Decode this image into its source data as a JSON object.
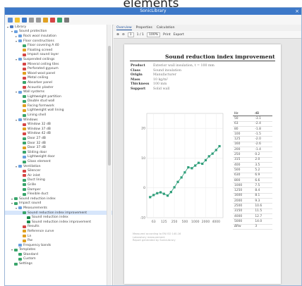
{
  "header": {
    "title": "elements"
  },
  "window": {
    "title": "SonicLibrary",
    "close": "×"
  },
  "tree": {
    "items": [
      {
        "label": "Library",
        "indent": 0,
        "color": "#4a78c2",
        "exp": "▾"
      },
      {
        "label": "Sound protection",
        "indent": 1,
        "color": "#6aa0e0",
        "exp": "▾"
      },
      {
        "label": "Rock wool insulation",
        "indent": 2,
        "color": "#6aa0e0",
        "exp": "▸"
      },
      {
        "label": "Floor constructions",
        "indent": 2,
        "color": "#6aa0e0",
        "exp": "▾"
      },
      {
        "label": "Floor covering A 40",
        "indent": 3,
        "color": "#39a56b",
        "exp": ""
      },
      {
        "label": "Floating screed",
        "indent": 3,
        "color": "#e0a020",
        "exp": ""
      },
      {
        "label": "Impact sound layer",
        "indent": 3,
        "color": "#d64545",
        "exp": ""
      },
      {
        "label": "Suspended ceilings",
        "indent": 2,
        "color": "#6aa0e0",
        "exp": "▾"
      },
      {
        "label": "Mineral ceiling tiles",
        "indent": 3,
        "color": "#d64545",
        "exp": ""
      },
      {
        "label": "Perforated gypsum",
        "indent": 3,
        "color": "#d64545",
        "exp": ""
      },
      {
        "label": "Wood wool panel",
        "indent": 3,
        "color": "#e0a020",
        "exp": ""
      },
      {
        "label": "Metal ceiling",
        "indent": 3,
        "color": "#d64545",
        "exp": ""
      },
      {
        "label": "Absorber panel",
        "indent": 3,
        "color": "#39a56b",
        "exp": ""
      },
      {
        "label": "Acoustic plaster",
        "indent": 3,
        "color": "#d64545",
        "exp": ""
      },
      {
        "label": "Wall systems",
        "indent": 2,
        "color": "#6aa0e0",
        "exp": "▾"
      },
      {
        "label": "Lightweight partition",
        "indent": 3,
        "color": "#39a56b",
        "exp": ""
      },
      {
        "label": "Double stud wall",
        "indent": 3,
        "color": "#39a56b",
        "exp": ""
      },
      {
        "label": "Facing formwork",
        "indent": 3,
        "color": "#e0a020",
        "exp": ""
      },
      {
        "label": "Lightweight wall lining",
        "indent": 3,
        "color": "#e0a020",
        "exp": ""
      },
      {
        "label": "Lining shell",
        "indent": 3,
        "color": "#39a56b",
        "exp": ""
      },
      {
        "label": "Windows",
        "indent": 2,
        "color": "#6aa0e0",
        "exp": "▾"
      },
      {
        "label": "Window 32 dB",
        "indent": 3,
        "color": "#d64545",
        "exp": ""
      },
      {
        "label": "Window 37 dB",
        "indent": 3,
        "color": "#e0a020",
        "exp": ""
      },
      {
        "label": "Window 42 dB",
        "indent": 3,
        "color": "#d64545",
        "exp": ""
      },
      {
        "label": "Door 27 dB",
        "indent": 3,
        "color": "#39a56b",
        "exp": ""
      },
      {
        "label": "Door 32 dB",
        "indent": 3,
        "color": "#39a56b",
        "exp": ""
      },
      {
        "label": "Door 37 dB",
        "indent": 3,
        "color": "#e0a020",
        "exp": ""
      },
      {
        "label": "Sliding door",
        "indent": 3,
        "color": "#39a56b",
        "exp": ""
      },
      {
        "label": "Lightweight door",
        "indent": 3,
        "color": "#6aa0e0",
        "exp": ""
      },
      {
        "label": "Glass element",
        "indent": 3,
        "color": "#39a56b",
        "exp": ""
      },
      {
        "label": "Ventilation",
        "indent": 2,
        "color": "#6aa0e0",
        "exp": "▾"
      },
      {
        "label": "Silencer",
        "indent": 3,
        "color": "#d64545",
        "exp": ""
      },
      {
        "label": "Air inlet",
        "indent": 3,
        "color": "#d64545",
        "exp": ""
      },
      {
        "label": "Duct lining",
        "indent": 3,
        "color": "#39a56b",
        "exp": ""
      },
      {
        "label": "Grille",
        "indent": 3,
        "color": "#39a56b",
        "exp": ""
      },
      {
        "label": "Damper",
        "indent": 3,
        "color": "#39a56b",
        "exp": ""
      },
      {
        "label": "Flexible duct",
        "indent": 3,
        "color": "#39a56b",
        "exp": ""
      },
      {
        "label": "Sound reduction index",
        "indent": 1,
        "color": "#39a56b",
        "exp": "▾"
      },
      {
        "label": "Impact sound",
        "indent": 1,
        "color": "#39a56b",
        "exp": "▾"
      },
      {
        "label": "Measurements",
        "indent": 2,
        "color": "#6aa0e0",
        "exp": "▾"
      },
      {
        "label": "Sound reduction index improvement",
        "indent": 3,
        "color": "#39a56b",
        "exp": "",
        "sel": true
      },
      {
        "label": "Sound reduction index",
        "indent": 4,
        "color": "#1b8a4c",
        "exp": ""
      },
      {
        "label": "Sound reduction index improvement",
        "indent": 4,
        "color": "#1b8a4c",
        "exp": ""
      },
      {
        "label": "Results",
        "indent": 3,
        "color": "#d64545",
        "exp": ""
      },
      {
        "label": "Reference curve",
        "indent": 3,
        "color": "#e0a020",
        "exp": ""
      },
      {
        "label": "Ln",
        "indent": 3,
        "color": "#e0a020",
        "exp": ""
      },
      {
        "label": "Rw",
        "indent": 3,
        "color": "#e0a020",
        "exp": ""
      },
      {
        "label": "Frequency bands",
        "indent": 2,
        "color": "#6aa0e0",
        "exp": ""
      },
      {
        "label": "Templates",
        "indent": 1,
        "color": "#39a56b",
        "exp": "▾"
      },
      {
        "label": "Standard",
        "indent": 2,
        "color": "#39a56b",
        "exp": ""
      },
      {
        "label": "Custom",
        "indent": 2,
        "color": "#39a56b",
        "exp": ""
      },
      {
        "label": "Settings",
        "indent": 1,
        "color": "#39a56b",
        "exp": ""
      }
    ]
  },
  "right": {
    "tabs": [
      {
        "label": "Overview"
      },
      {
        "label": "Properties"
      },
      {
        "label": "Calculation"
      }
    ],
    "toolbar": {
      "page": "1",
      "pages": "1 / 1",
      "zoom": "100%",
      "print": "Print",
      "export": "Export"
    }
  },
  "report": {
    "title": "Sound reduction index improvement",
    "props": [
      {
        "k": "Product",
        "v": "Exterior wall insulation, t = 100 mm"
      },
      {
        "k": "Class",
        "v": "Sound insulation"
      },
      {
        "k": "Origin",
        "v": "Manufacturer"
      },
      {
        "k": "Mass",
        "v": "10 kg/m²"
      },
      {
        "k": "Thickness",
        "v": "100 mm"
      },
      {
        "k": "Support",
        "v": "Solid wall"
      }
    ],
    "table": {
      "headers": [
        "Hz",
        "dB"
      ],
      "rows": [
        [
          "50",
          "-3.1"
        ],
        [
          "63",
          "-2.4"
        ],
        [
          "80",
          "-1.8"
        ],
        [
          "100",
          "-1.5"
        ],
        [
          "125",
          "-2.0"
        ],
        [
          "160",
          "-2.6"
        ],
        [
          "200",
          "-1.4"
        ],
        [
          "250",
          "0.2"
        ],
        [
          "315",
          "2.0"
        ],
        [
          "400",
          "3.5"
        ],
        [
          "500",
          "5.2"
        ],
        [
          "630",
          "6.9"
        ],
        [
          "800",
          "6.6"
        ],
        [
          "1000",
          "7.5"
        ],
        [
          "1250",
          "8.4"
        ],
        [
          "1600",
          "8.1"
        ],
        [
          "2000",
          "9.3"
        ],
        [
          "2500",
          "10.6"
        ],
        [
          "3150",
          "11.5"
        ],
        [
          "4000",
          "12.7"
        ],
        [
          "5000",
          "14.0"
        ],
        [
          "ΔRw",
          "3"
        ]
      ]
    },
    "note": [
      "Measured according to EN ISO 140-16",
      "Laboratory measurement",
      "Report generated by SonicLibrary"
    ]
  },
  "chart_data": {
    "type": "line",
    "x": [
      50,
      63,
      80,
      100,
      125,
      160,
      200,
      250,
      315,
      400,
      500,
      630,
      800,
      1000,
      1250,
      1600,
      2000,
      2500,
      3150,
      4000,
      5000
    ],
    "values": [
      -3.1,
      -2.4,
      -1.8,
      -1.5,
      -2.0,
      -2.6,
      -1.4,
      0.2,
      2.0,
      3.5,
      5.2,
      6.9,
      6.6,
      7.5,
      8.4,
      8.1,
      9.3,
      10.6,
      11.5,
      12.7,
      14.0
    ],
    "xticks": [
      "63",
      "125",
      "250",
      "500",
      "1000",
      "2000",
      "4000"
    ],
    "yticks": [
      "-10",
      "0",
      "10",
      "20"
    ],
    "ylim": [
      -10,
      25
    ],
    "color": "#2f9e7a"
  }
}
